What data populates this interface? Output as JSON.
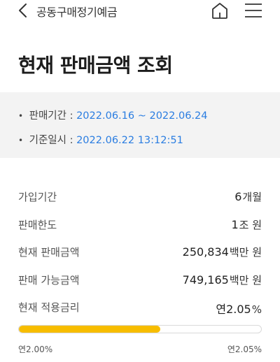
{
  "header": {
    "title": "공동구매정기예금",
    "back_icon": "chevron-left-icon",
    "home_icon": "home-icon",
    "menu_icon": "hamburger-menu-icon"
  },
  "page_title": "현재 판매금액 조회",
  "info": {
    "period_label": "판매기간 :",
    "period_value": "2022.06.16 ~ 2022.06.24",
    "base_label": "기준일시 :",
    "base_value": "2022.06.22 13:12:51",
    "accent_color": "#2a7de1"
  },
  "details": {
    "join_period": {
      "label": "가입기간",
      "value": "6",
      "unit": "개월"
    },
    "sales_limit": {
      "label": "판매한도",
      "value": "1",
      "unit": "조 원"
    },
    "current_sales": {
      "label": "현재 판매금액",
      "value": "250,834",
      "unit": "백만 원"
    },
    "available_sales": {
      "label": "판매 가능금액",
      "value": "749,165",
      "unit": "백만 원"
    },
    "current_rate": {
      "label": "현재 적용금리",
      "value": "연2.05",
      "unit": "%"
    }
  },
  "rate_bar": {
    "min_label": "연2.00",
    "min_unit": "%",
    "max_label": "연2.05",
    "max_unit": "%",
    "sold_fraction": 0.584,
    "fill_color": "#f7bd00"
  }
}
